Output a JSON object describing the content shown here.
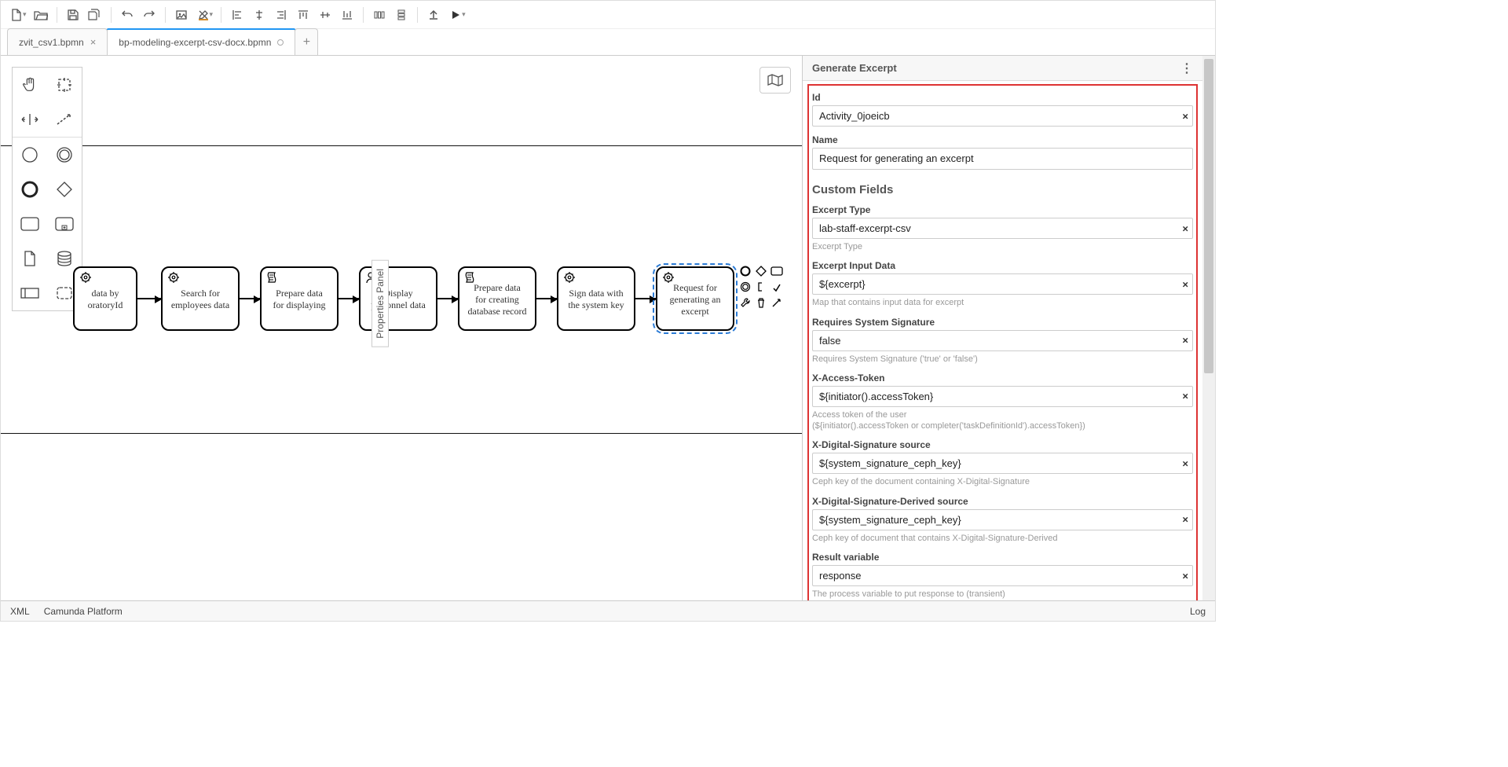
{
  "tabs": {
    "items": [
      {
        "label": "zvit_csv1.bpmn",
        "state": "close"
      },
      {
        "label": "bp-modeling-excerpt-csv-docx.bpmn",
        "state": "dirty"
      }
    ]
  },
  "nodes": {
    "n0": "data by\noratoryId",
    "n1": "Search for\nemployees data",
    "n2": "Prepare data\nfor displaying",
    "n3": "Display\npersonnel data",
    "n4": "Prepare data\nfor creating\ndatabase record",
    "n5": "Sign data with\nthe system key",
    "n6": "Request for\ngenerating an\nexcerpt"
  },
  "propsHandle": "Properties Panel",
  "panel": {
    "title": "Generate Excerpt",
    "id": {
      "label": "Id",
      "value": "Activity_0joeicb"
    },
    "name": {
      "label": "Name",
      "value": "Request for generating an excerpt"
    },
    "customTitle": "Custom Fields",
    "fields": [
      {
        "label": "Excerpt Type",
        "value": "lab-staff-excerpt-csv",
        "hint": "Excerpt Type",
        "clear": true
      },
      {
        "label": "Excerpt Input Data",
        "value": "${excerpt}",
        "hint": "Map that contains input data for excerpt",
        "clear": true
      },
      {
        "label": "Requires System Signature",
        "value": "false",
        "hint": "Requires System Signature ('true' or 'false')",
        "clear": true
      },
      {
        "label": "X-Access-Token",
        "value": "${initiator().accessToken}",
        "hint": "Access token of the user\n(${initiator().accessToken or completer('taskDefinitionId').accessToken})",
        "clear": true
      },
      {
        "label": "X-Digital-Signature source",
        "value": "${system_signature_ceph_key}",
        "hint": "Ceph key of the document containing X-Digital-Signature",
        "clear": true
      },
      {
        "label": "X-Digital-Signature-Derived source",
        "value": "${system_signature_ceph_key}",
        "hint": "Ceph key of document that contains X-Digital-Signature-Derived",
        "clear": true
      },
      {
        "label": "Result variable",
        "value": "response",
        "hint": "The process variable to put response to (transient)",
        "clear": true
      }
    ]
  },
  "footer": {
    "xml": "XML",
    "platform": "Camunda Platform",
    "log": "Log"
  }
}
